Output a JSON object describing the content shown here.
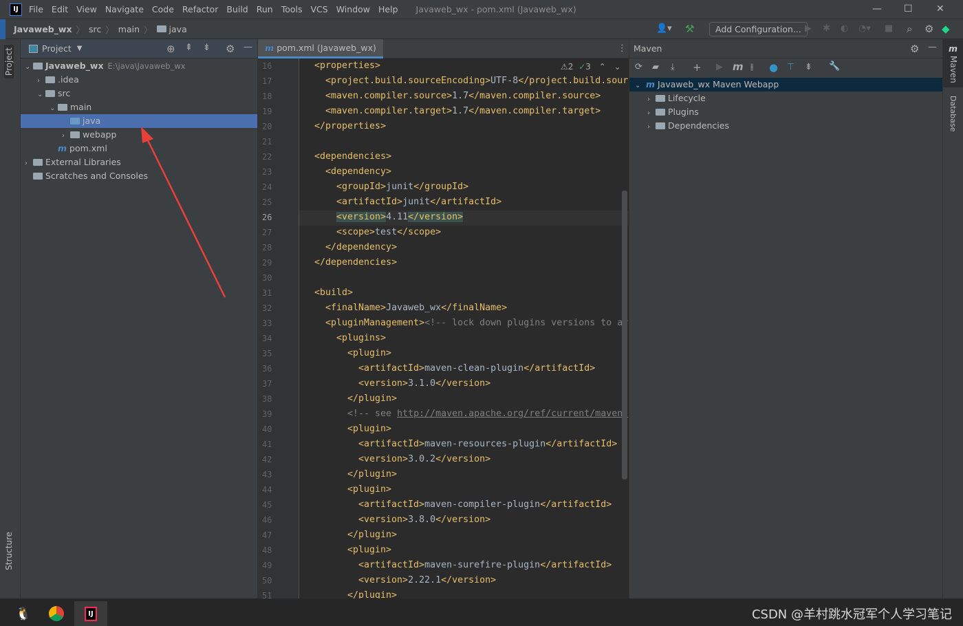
{
  "titlebar": {
    "menus": [
      "File",
      "Edit",
      "View",
      "Navigate",
      "Code",
      "Refactor",
      "Build",
      "Run",
      "Tools",
      "VCS",
      "Window",
      "Help"
    ],
    "title": "Javaweb_wx - pom.xml (Javaweb_wx)",
    "logo": "IJ"
  },
  "breadcrumb": [
    "Javaweb_wx",
    "src",
    "main",
    "java"
  ],
  "toolbar": {
    "add_config": "Add Configuration..."
  },
  "left_stripe": {
    "project": "Project",
    "structure": "Structure"
  },
  "project": {
    "title": "Project",
    "tree": [
      {
        "label": "Javaweb_wx",
        "path": "E:\\java\\Javaweb_wx",
        "depth": 0,
        "expanded": true,
        "icon": "module-folder"
      },
      {
        "label": ".idea",
        "depth": 1,
        "expanded": false,
        "icon": "folder"
      },
      {
        "label": "src",
        "depth": 1,
        "expanded": true,
        "icon": "folder"
      },
      {
        "label": "main",
        "depth": 2,
        "expanded": true,
        "icon": "folder"
      },
      {
        "label": "java",
        "depth": 3,
        "selected": true,
        "icon": "source-folder"
      },
      {
        "label": "webapp",
        "depth": 3,
        "expanded": false,
        "icon": "web-folder"
      },
      {
        "label": "pom.xml",
        "depth": 2,
        "icon": "maven-file"
      },
      {
        "label": "External Libraries",
        "depth": 0,
        "expanded": false,
        "icon": "libraries"
      },
      {
        "label": "Scratches and Consoles",
        "depth": 0,
        "icon": "scratches"
      }
    ]
  },
  "editor": {
    "tab": "pom.xml (Javaweb_wx)",
    "warnings": "2",
    "checks": "3",
    "current_line": 26,
    "lines": [
      {
        "n": 16,
        "i": 0,
        "s": [
          [
            "tg",
            "<properties>"
          ]
        ]
      },
      {
        "n": 17,
        "i": 1,
        "s": [
          [
            "tg",
            "<project.build.sourceEncoding>"
          ],
          [
            "tx",
            "UTF-8"
          ],
          [
            "tg",
            "</project.build.sour"
          ]
        ]
      },
      {
        "n": 18,
        "i": 1,
        "s": [
          [
            "tg",
            "<maven.compiler.source>"
          ],
          [
            "tx",
            "1.7"
          ],
          [
            "tg",
            "</maven.compiler.source>"
          ]
        ]
      },
      {
        "n": 19,
        "i": 1,
        "s": [
          [
            "tg",
            "<maven.compiler.target>"
          ],
          [
            "tx",
            "1.7"
          ],
          [
            "tg",
            "</maven.compiler.target>"
          ]
        ]
      },
      {
        "n": 20,
        "i": 0,
        "s": [
          [
            "tg",
            "</properties>"
          ]
        ]
      },
      {
        "n": 21,
        "i": 0,
        "s": []
      },
      {
        "n": 22,
        "i": 0,
        "s": [
          [
            "tg",
            "<dependencies>"
          ]
        ]
      },
      {
        "n": 23,
        "i": 1,
        "s": [
          [
            "tg",
            "<dependency>"
          ]
        ]
      },
      {
        "n": 24,
        "i": 2,
        "s": [
          [
            "tg",
            "<groupId>"
          ],
          [
            "tx",
            "junit"
          ],
          [
            "tg",
            "</groupId>"
          ]
        ]
      },
      {
        "n": 25,
        "i": 2,
        "s": [
          [
            "tg",
            "<artifactId>"
          ],
          [
            "tx",
            "junit"
          ],
          [
            "tg",
            "</artifactId>"
          ]
        ]
      },
      {
        "n": 26,
        "i": 2,
        "s": [
          [
            "tg",
            "<version>"
          ],
          [
            "tx",
            "4.11"
          ],
          [
            "tg",
            "</version>"
          ]
        ]
      },
      {
        "n": 27,
        "i": 2,
        "s": [
          [
            "tg",
            "<scope>"
          ],
          [
            "tx",
            "test"
          ],
          [
            "tg",
            "</scope>"
          ]
        ]
      },
      {
        "n": 28,
        "i": 1,
        "s": [
          [
            "tg",
            "</dependency>"
          ]
        ]
      },
      {
        "n": 29,
        "i": 0,
        "s": [
          [
            "tg",
            "</dependencies>"
          ]
        ]
      },
      {
        "n": 30,
        "i": 0,
        "s": []
      },
      {
        "n": 31,
        "i": 0,
        "s": [
          [
            "tg",
            "<build>"
          ]
        ]
      },
      {
        "n": 32,
        "i": 1,
        "s": [
          [
            "tg",
            "<finalName>"
          ],
          [
            "tx",
            "Javaweb_wx"
          ],
          [
            "tg",
            "</finalName>"
          ]
        ]
      },
      {
        "n": 33,
        "i": 1,
        "s": [
          [
            "tg",
            "<pluginManagement>"
          ],
          [
            "cm",
            "<!-- lock down plugins versions to av"
          ]
        ]
      },
      {
        "n": 34,
        "i": 2,
        "s": [
          [
            "tg",
            "<plugins>"
          ]
        ]
      },
      {
        "n": 35,
        "i": 3,
        "s": [
          [
            "tg",
            "<plugin>"
          ]
        ]
      },
      {
        "n": 36,
        "i": 4,
        "s": [
          [
            "tg",
            "<artifactId>"
          ],
          [
            "tx",
            "maven-clean-plugin"
          ],
          [
            "tg",
            "</artifactId>"
          ]
        ]
      },
      {
        "n": 37,
        "i": 4,
        "s": [
          [
            "tg",
            "<version>"
          ],
          [
            "tx",
            "3.1.0"
          ],
          [
            "tg",
            "</version>"
          ]
        ]
      },
      {
        "n": 38,
        "i": 3,
        "s": [
          [
            "tg",
            "</plugin>"
          ]
        ]
      },
      {
        "n": 39,
        "i": 3,
        "s": [
          [
            "cm",
            "<!-- see "
          ],
          [
            "lk",
            "http://maven.apache.org/ref/current/maven-"
          ]
        ]
      },
      {
        "n": 40,
        "i": 3,
        "s": [
          [
            "tg",
            "<plugin>"
          ]
        ]
      },
      {
        "n": 41,
        "i": 4,
        "s": [
          [
            "tg",
            "<artifactId>"
          ],
          [
            "tx",
            "maven-resources-plugin"
          ],
          [
            "tg",
            "</artifactId>"
          ]
        ]
      },
      {
        "n": 42,
        "i": 4,
        "s": [
          [
            "tg",
            "<version>"
          ],
          [
            "tx",
            "3.0.2"
          ],
          [
            "tg",
            "</version>"
          ]
        ]
      },
      {
        "n": 43,
        "i": 3,
        "s": [
          [
            "tg",
            "</plugin>"
          ]
        ]
      },
      {
        "n": 44,
        "i": 3,
        "s": [
          [
            "tg",
            "<plugin>"
          ]
        ]
      },
      {
        "n": 45,
        "i": 4,
        "s": [
          [
            "tg",
            "<artifactId>"
          ],
          [
            "tx",
            "maven-compiler-plugin"
          ],
          [
            "tg",
            "</artifactId>"
          ]
        ]
      },
      {
        "n": 46,
        "i": 4,
        "s": [
          [
            "tg",
            "<version>"
          ],
          [
            "tx",
            "3.8.0"
          ],
          [
            "tg",
            "</version>"
          ]
        ]
      },
      {
        "n": 47,
        "i": 3,
        "s": [
          [
            "tg",
            "</plugin>"
          ]
        ]
      },
      {
        "n": 48,
        "i": 3,
        "s": [
          [
            "tg",
            "<plugin>"
          ]
        ]
      },
      {
        "n": 49,
        "i": 4,
        "s": [
          [
            "tg",
            "<artifactId>"
          ],
          [
            "tx",
            "maven-surefire-plugin"
          ],
          [
            "tg",
            "</artifactId>"
          ]
        ]
      },
      {
        "n": 50,
        "i": 4,
        "s": [
          [
            "tg",
            "<version>"
          ],
          [
            "tx",
            "2.22.1"
          ],
          [
            "tg",
            "</version>"
          ]
        ]
      },
      {
        "n": 51,
        "i": 3,
        "s": [
          [
            "tg",
            "</plugin>"
          ]
        ]
      }
    ]
  },
  "maven": {
    "title": "Maven",
    "root": "Javaweb_wx Maven Webapp",
    "children": [
      "Lifecycle",
      "Plugins",
      "Dependencies"
    ]
  },
  "right_stripe": {
    "maven": "Maven",
    "database": "Database"
  },
  "taskbar": {
    "apps": [
      "qq",
      "chrome",
      "intellij-idea"
    ],
    "watermark": "CSDN @羊村跳水冠军个人学习笔记"
  },
  "colors": {
    "selection": "#4b6eaf",
    "tag": "#e8bf6a",
    "text": "#a9b7c6",
    "annotation_arrow": "#e8413a"
  }
}
